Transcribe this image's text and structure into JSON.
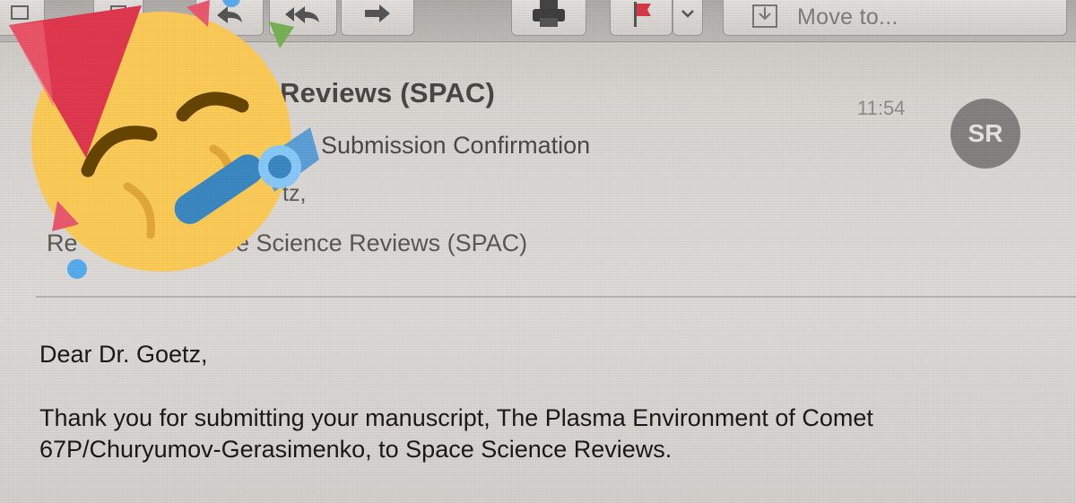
{
  "toolbar": {
    "move_label": "Move to...",
    "buttons": [
      "archive-icon",
      "delete-icon",
      "reply-icon",
      "reply-all-icon",
      "forward-icon",
      "print-icon",
      "flag-icon",
      "chevron-down-icon",
      "move-icon"
    ],
    "flag_color": "#d63b45"
  },
  "message": {
    "sender": "Reviews (SPAC)",
    "time": "11:54",
    "avatar_initials": "SR",
    "subject": "Submission Confirmation",
    "to": "tz,",
    "reply_prefix": "Re",
    "reply_to": "ce Science Reviews (SPAC)"
  },
  "body": {
    "greeting": "Dear Dr. Goetz,",
    "paragraph": "Thank you for submitting your manuscript, The Plasma Environment of Comet 67P/Churyumov-Gerasimenko, to Space Science Reviews."
  },
  "overlay": {
    "emoji": "party-face-emoji",
    "hat_color": "#e0384f",
    "face_color": "#fdcb58",
    "horn_color": "#3b88c3"
  }
}
